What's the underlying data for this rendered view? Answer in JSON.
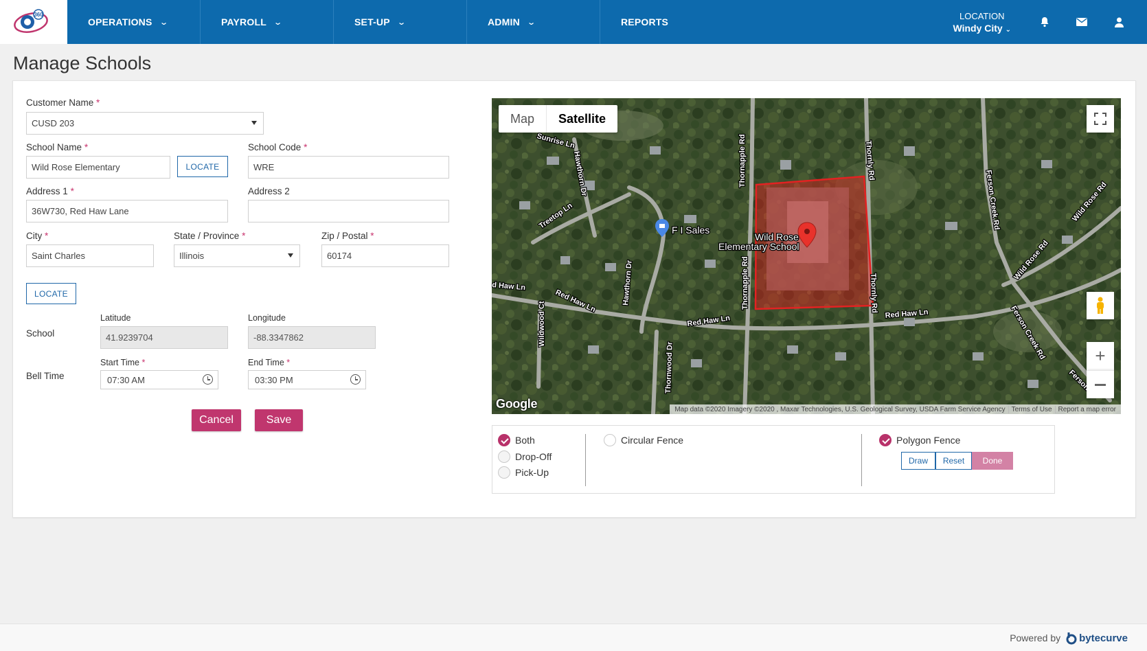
{
  "nav": {
    "items": [
      {
        "label": "OPERATIONS"
      },
      {
        "label": "PAYROLL"
      },
      {
        "label": "SET-UP"
      },
      {
        "label": "ADMIN"
      },
      {
        "label": "REPORTS"
      }
    ],
    "location_label": "LOCATION",
    "location_value": "Windy City",
    "brand_text": "360"
  },
  "page": {
    "title": "Manage Schools"
  },
  "form": {
    "customer_name_label": "Customer Name",
    "customer_name_value": "CUSD 203",
    "school_name_label": "School Name",
    "school_name_value": "Wild Rose Elementary",
    "locate_label": "LOCATE",
    "school_code_label": "School Code",
    "school_code_value": "WRE",
    "address1_label": "Address 1",
    "address1_value": "36W730, Red Haw Lane",
    "address2_label": "Address 2",
    "address2_value": "",
    "city_label": "City",
    "city_value": "Saint Charles",
    "state_label": "State / Province",
    "state_value": "Illinois",
    "zip_label": "Zip / Postal",
    "zip_value": "60174",
    "required_mark": "*",
    "school_row_label": "School",
    "latitude_label": "Latitude",
    "latitude_value": "41.9239704",
    "longitude_label": "Longitude",
    "longitude_value": "-88.3347862",
    "bell_time_label": "Bell Time",
    "start_time_label": "Start Time",
    "start_time_value": "07:30 AM",
    "end_time_label": "End Time",
    "end_time_value": "03:30 PM",
    "cancel_label": "Cancel",
    "save_label": "Save"
  },
  "map": {
    "type_map": "Map",
    "type_satellite": "Satellite",
    "google_label": "Google",
    "attribution": "Map data ©2020 Imagery ©2020 , Maxar Technologies, U.S. Geological Survey, USDA Farm Service Agency",
    "terms": "Terms of Use",
    "report": "Report a map error",
    "poi_label": "F I Sales",
    "school_label_line1": "Wild Rose",
    "school_label_line2": "Elementary School",
    "streets": {
      "sunrise": "Sunrise Ln",
      "hawthorn": "Hawthorn Dr",
      "treetop": "Treetop Ln",
      "thornapple": "Thornapple Rd",
      "thornly": "Thornly Rd",
      "ferson": "Ferson Creek Rd",
      "wildrose1": "Wild Rose Rd",
      "wildrose2": "Wild Rose Rd",
      "redhaw1": "d Haw Ln",
      "redhaw2": "Red Haw Ln",
      "redhaw3": "Red Haw Ln",
      "redhaw4": "Red Haw Ln",
      "wildwood": "Wildwood Ct",
      "thornwood": "Thornwood Dr",
      "ferson2": "Ferson Creek Rd",
      "ferson3": "Ferson Cr"
    }
  },
  "fence": {
    "both": "Both",
    "dropoff": "Drop-Off",
    "pickup": "Pick-Up",
    "circular": "Circular Fence",
    "polygon": "Polygon Fence",
    "draw": "Draw",
    "reset": "Reset",
    "done": "Done"
  },
  "footer": {
    "powered_by": "Powered by",
    "brand": "bytecurve"
  },
  "colors": {
    "nav": "#0d6aad",
    "accent": "#c0366e",
    "link": "#1f67a8"
  }
}
